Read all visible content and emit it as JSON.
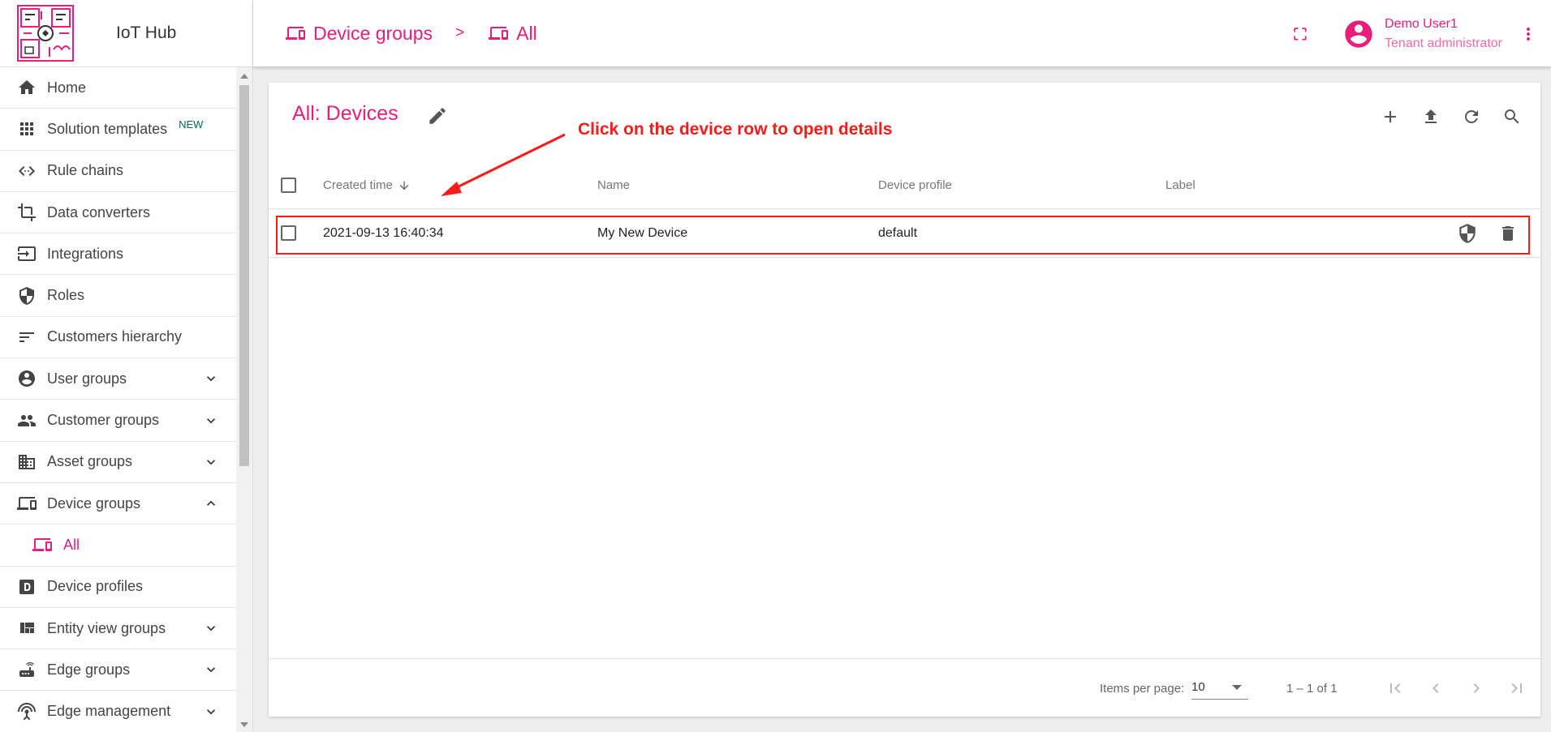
{
  "app": {
    "brand_name": "IoT Hub"
  },
  "colors": {
    "accent": "#e91e7a",
    "annotation": "#ff1a1a",
    "badge": "#00695c"
  },
  "sidebar": {
    "items": [
      {
        "label": "Home",
        "icon": "home-icon"
      },
      {
        "label": "Solution templates",
        "icon": "apps-icon",
        "badge": "NEW"
      },
      {
        "label": "Rule chains",
        "icon": "code-icon"
      },
      {
        "label": "Data converters",
        "icon": "crop-icon"
      },
      {
        "label": "Integrations",
        "icon": "input-icon"
      },
      {
        "label": "Roles",
        "icon": "shield-icon"
      },
      {
        "label": "Customers hierarchy",
        "icon": "sort-icon"
      },
      {
        "label": "User groups",
        "icon": "account-circle-icon",
        "expand": "chevron-down-icon"
      },
      {
        "label": "Customer groups",
        "icon": "people-icon",
        "expand": "chevron-down-icon"
      },
      {
        "label": "Asset groups",
        "icon": "domain-icon",
        "expand": "chevron-down-icon"
      },
      {
        "label": "Device groups",
        "icon": "devices-icon",
        "expand": "chevron-up-icon"
      },
      {
        "label": "All",
        "icon": "devices-icon"
      },
      {
        "label": "Device profiles",
        "icon": "device-profile-icon"
      },
      {
        "label": "Entity view groups",
        "icon": "view-quilt-icon",
        "expand": "chevron-down-icon"
      },
      {
        "label": "Edge groups",
        "icon": "router-icon",
        "expand": "chevron-down-icon"
      },
      {
        "label": "Edge management",
        "icon": "settings-input-antenna-icon",
        "expand": "chevron-down-icon"
      }
    ]
  },
  "header": {
    "breadcrumb": [
      {
        "label": "Device groups",
        "icon": "devices-icon"
      },
      {
        "label": "All",
        "icon": "devices-icon"
      }
    ],
    "separator": ">",
    "user": {
      "name": "Demo User1",
      "role": "Tenant administrator"
    }
  },
  "card": {
    "title": "All: Devices",
    "annotation": "Click on the device row to open details",
    "columns": [
      "Created time",
      "Name",
      "Device profile",
      "Label"
    ],
    "rows": [
      {
        "created_time": "2021-09-13 16:40:34",
        "name": "My New Device",
        "device_profile": "default",
        "label": ""
      }
    ],
    "footer": {
      "items_per_page_label": "Items per page:",
      "items_per_page": "10",
      "range": "1 – 1 of 1"
    }
  }
}
